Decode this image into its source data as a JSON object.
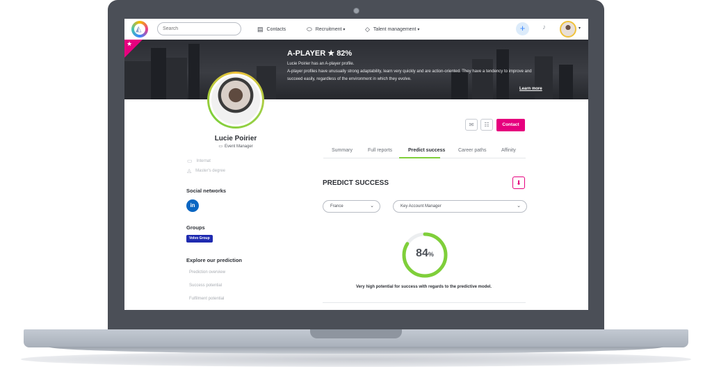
{
  "topbar": {
    "search_placeholder": "Search",
    "nav": [
      {
        "label": "Contacts",
        "icon": "contact-card-icon"
      },
      {
        "label": "Recruitment",
        "icon": "handshake-icon"
      },
      {
        "label": "Talent management",
        "icon": "diamond-icon"
      }
    ],
    "add_symbol": "+"
  },
  "banner": {
    "title": "A-PLAYER ★ 82%",
    "line1": "Lucie Poirier has an A-player profile.",
    "line2": "A-player profiles have unusually strong adaptability, learn very quickly and are action-oriented. They have a tendency to improve and",
    "line3": "succeed easily, regardless of the environment in which they evolve.",
    "learn_more": "Learn more"
  },
  "profile": {
    "name": "Lucie Poirier",
    "role": "Event Manager",
    "internship": "Internat",
    "degree": "Master's degree",
    "social_title": "Social networks",
    "linkedin": "in",
    "groups_title": "Groups",
    "group_badge": "Volvo Group",
    "explore_title": "Explore our prediction",
    "explore_links": [
      "Prediction overview",
      "Success potential",
      "Fulfilment potential"
    ]
  },
  "actions": {
    "contact_label": "Contact"
  },
  "tabs": [
    "Summary",
    "Full reports",
    "Predict success",
    "Career paths",
    "Affinity"
  ],
  "predict": {
    "title": "PREDICT SUCCESS",
    "country": "France",
    "job": "Key Account Manager",
    "score_value": "84",
    "score_unit": "%",
    "score_fraction": 0.84,
    "caption": "Very high potential for success with regards to the predictive model."
  },
  "colors": {
    "accent_pink": "#e6007e",
    "accent_green": "#7fcf3a",
    "badge_blue": "#1f2bb0",
    "linkedin_blue": "#0a66c2"
  }
}
